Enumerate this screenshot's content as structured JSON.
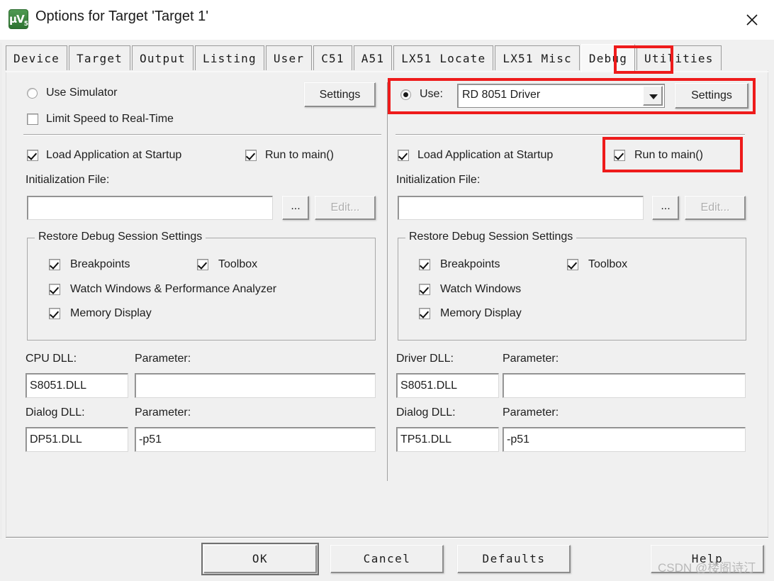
{
  "window": {
    "title": "Options for Target 'Target 1'",
    "icon": "uvision-logo-icon",
    "close_label": "×"
  },
  "tabs": {
    "items": [
      {
        "label": "Device",
        "selected": false
      },
      {
        "label": "Target",
        "selected": false
      },
      {
        "label": "Output",
        "selected": false
      },
      {
        "label": "Listing",
        "selected": false
      },
      {
        "label": "User",
        "selected": false
      },
      {
        "label": "C51",
        "selected": false
      },
      {
        "label": "A51",
        "selected": false
      },
      {
        "label": "LX51 Locate",
        "selected": false
      },
      {
        "label": "LX51 Misc",
        "selected": false
      },
      {
        "label": "Debug",
        "selected": true
      },
      {
        "label": "Utilities",
        "selected": false
      }
    ],
    "selected": "Debug"
  },
  "simulator_panel": {
    "use_simulator_label": "Use Simulator",
    "use_simulator_checked": false,
    "limit_speed_label": "Limit Speed to Real-Time",
    "limit_speed_checked": false,
    "settings_label": "Settings",
    "load_app_label": "Load Application at Startup",
    "load_app_checked": true,
    "run_to_main_label": "Run to main()",
    "run_to_main_checked": true,
    "init_file_label": "Initialization File:",
    "init_file_value": "",
    "browse_label": "...",
    "edit_label": "Edit...",
    "edit_disabled": true,
    "restore_group_title": "Restore Debug Session Settings",
    "restore_items": [
      {
        "label": "Breakpoints",
        "checked": true
      },
      {
        "label": "Toolbox",
        "checked": true
      },
      {
        "label": "Watch Windows & Performance Analyzer",
        "checked": true
      },
      {
        "label": "Memory Display",
        "checked": true
      }
    ],
    "cpu_dll_label": "CPU DLL:",
    "cpu_dll_value": "S8051.DLL",
    "cpu_param_label": "Parameter:",
    "cpu_param_value": "",
    "dialog_dll_label": "Dialog DLL:",
    "dialog_dll_value": "DP51.DLL",
    "dialog_param_label": "Parameter:",
    "dialog_param_value": "-p51"
  },
  "driver_panel": {
    "use_label": "Use:",
    "use_checked": true,
    "driver_value": "RD 8051 Driver",
    "settings_label": "Settings",
    "load_app_label": "Load Application at Startup",
    "load_app_checked": true,
    "run_to_main_label": "Run to main()",
    "run_to_main_checked": true,
    "init_file_label": "Initialization File:",
    "init_file_value": "",
    "browse_label": "...",
    "edit_label": "Edit...",
    "edit_disabled": true,
    "restore_group_title": "Restore Debug Session Settings",
    "restore_items": [
      {
        "label": "Breakpoints",
        "checked": true
      },
      {
        "label": "Toolbox",
        "checked": true
      },
      {
        "label": "Watch Windows",
        "checked": true
      },
      {
        "label": "Memory Display",
        "checked": true
      }
    ],
    "driver_dll_label": "Driver DLL:",
    "driver_dll_value": "S8051.DLL",
    "driver_param_label": "Parameter:",
    "driver_param_value": "",
    "dialog_dll_label": "Dialog DLL:",
    "dialog_dll_value": "TP51.DLL",
    "dialog_param_label": "Parameter:",
    "dialog_param_value": "-p51"
  },
  "footer": {
    "ok_label": "OK",
    "cancel_label": "Cancel",
    "defaults_label": "Defaults",
    "help_label": "Help"
  },
  "annotations": {
    "highlight_color": "#ee1b1b",
    "boxes": [
      "debug-tab",
      "use-driver-row",
      "run-to-main-right"
    ]
  },
  "watermark": {
    "text": "CSDN @楼阁诗汀"
  }
}
